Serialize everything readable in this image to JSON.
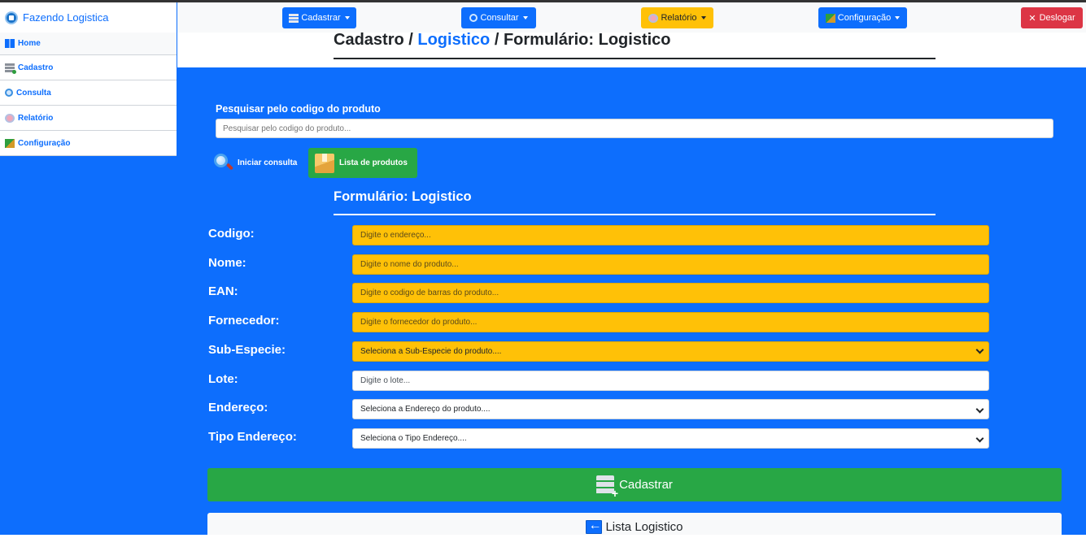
{
  "brand": {
    "name": "Fazendo Logistica"
  },
  "sidebar": {
    "items": [
      {
        "label": "Home",
        "icon": "dashboard-icon"
      },
      {
        "label": "Cadastro",
        "icon": "database-add-icon"
      },
      {
        "label": "Consulta",
        "icon": "search-icon"
      },
      {
        "label": "Relatório",
        "icon": "report-icon"
      },
      {
        "label": "Configuração",
        "icon": "settings-icon"
      }
    ]
  },
  "navbar": {
    "cadastrar": "Cadastrar",
    "consultar": "Consultar",
    "relatorio": "Relatório",
    "configuracao": "Configuração",
    "deslogar": "Deslogar",
    "colors": {
      "primary": "#0d6efd",
      "warning": "#ffc107",
      "danger": "#dc3545",
      "success": "#28a745"
    }
  },
  "breadcrumb": {
    "part1": "Cadastro",
    "sep1": " / ",
    "link": "Logistico",
    "sep2": " / ",
    "part3": "Formulário: Logistico"
  },
  "search": {
    "label": "Pesquisar pelo codigo do produto",
    "placeholder": "Pesquisar pelo codigo do produto...",
    "iniciar": "Iniciar consulta",
    "lista": "Lista de produtos"
  },
  "form": {
    "title": "Formulário: Logistico",
    "fields": [
      {
        "label": "Codigo:",
        "placeholder": "Digite o endereço..."
      },
      {
        "label": "Nome:",
        "placeholder": "Digite o nome do produto..."
      },
      {
        "label": "EAN:",
        "placeholder": "Digite o codigo de barras do produto..."
      },
      {
        "label": "Fornecedor:",
        "placeholder": "Digite o fornecedor do produto..."
      },
      {
        "label": "Sub-Especie:",
        "value": "Seleciona a Sub-Especie do produto...."
      },
      {
        "label": "Lote:",
        "placeholder": "Digite o lote..."
      },
      {
        "label": "Endereço:",
        "value": "Seleciona a Endereço do produto...."
      },
      {
        "label": "Tipo Endereço:",
        "value": "Seleciona o Tipo Endereço...."
      }
    ],
    "submit": "Cadastrar",
    "list": "Lista Logistico"
  }
}
